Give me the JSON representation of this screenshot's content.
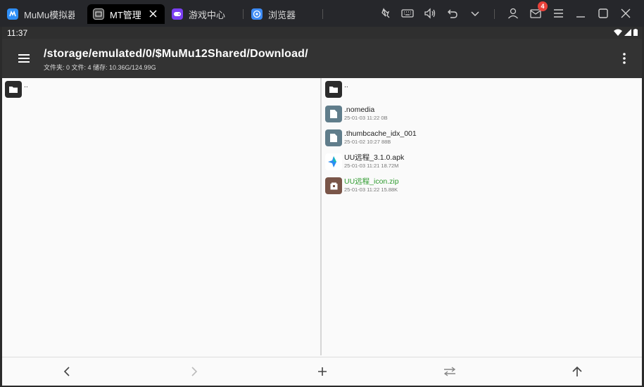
{
  "tabs": [
    {
      "label": "MuMu模拟器",
      "icon": "mumu-logo-icon",
      "color": "#2f8ff8"
    },
    {
      "label": "MT管理器",
      "icon": "mt-manager-icon",
      "color": "#444444"
    },
    {
      "label": "游戏中心",
      "icon": "gamepad-icon",
      "color": "#7b3ff2"
    },
    {
      "label": "浏览器",
      "icon": "browser-icon",
      "color": "#3d8bf5"
    }
  ],
  "toolbar": {
    "icons": [
      "pin-icon",
      "keyboard-icon",
      "volume-icon",
      "back-arrow-icon",
      "chevron-down-icon",
      "user-icon",
      "mail-icon",
      "menu-icon",
      "minimize-icon",
      "maximize-icon",
      "close-icon"
    ],
    "mail_badge": "4"
  },
  "status": {
    "time": "11:37"
  },
  "appbar": {
    "path": "/storage/emulated/0/$MuMu12Shared/Download/",
    "info": "文件夹: 0  文件: 4  储存: 10.36G/124.99G"
  },
  "left_panel": {
    "parent": ".."
  },
  "right_panel": {
    "parent": "..",
    "files": [
      {
        "name": ".nomedia",
        "meta": "25-01-03 11:22  0B",
        "icon": "file-icon",
        "color": "#607d8b",
        "name_color": "#222222"
      },
      {
        "name": ".thumbcache_idx_001",
        "meta": "25-01-02 10:27  88B",
        "icon": "file-icon",
        "color": "#607d8b",
        "name_color": "#222222"
      },
      {
        "name": "UU远程_3.1.0.apk",
        "meta": "25-01-03 11:21  18.72M",
        "icon": "apk-app-icon",
        "color": "#ffffff",
        "name_color": "#222222"
      },
      {
        "name": "UU远程_icon.zip",
        "meta": "25-01-03 11:22  15.88K",
        "icon": "zip-archive-icon",
        "color": "#795548",
        "name_color": "#2e9b2e"
      }
    ]
  },
  "bottombar": {
    "buttons": [
      "back-icon",
      "forward-icon",
      "add-icon",
      "swap-icon",
      "up-icon"
    ]
  }
}
